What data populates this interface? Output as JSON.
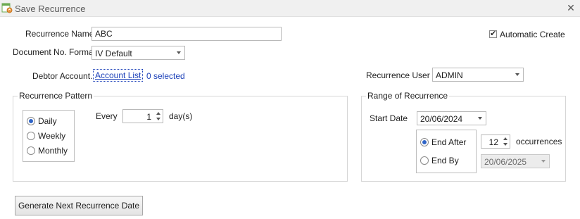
{
  "window": {
    "title": "Save Recurrence",
    "close_symbol": "✕"
  },
  "form": {
    "recurrence_name_label": "Recurrence Name",
    "recurrence_name_value": "ABC",
    "doc_format_label": "Document No. Format",
    "doc_format_value": "IV Default",
    "debtor_account_label": "Debtor Account.",
    "account_list_link": "Account List",
    "selected_text": "0 selected",
    "automatic_create_label": "Automatic Create",
    "automatic_create_checked": true,
    "recurrence_user_label": "Recurrence User",
    "recurrence_user_value": "ADMIN"
  },
  "pattern": {
    "title": "Recurrence Pattern",
    "options": [
      {
        "label": "Daily",
        "checked": true
      },
      {
        "label": "Weekly",
        "checked": false
      },
      {
        "label": "Monthly",
        "checked": false
      }
    ],
    "every_label": "Every",
    "every_value": "1",
    "unit_label": "day(s)"
  },
  "range": {
    "title": "Range of Recurrence",
    "start_date_label": "Start Date",
    "start_date_value": "20/06/2024",
    "end_after_label": "End After",
    "end_after_checked": true,
    "occurrences_value": "12",
    "occurrences_label": "occurrences",
    "end_by_label": "End By",
    "end_by_checked": false,
    "end_by_value": "20/06/2025"
  },
  "buttons": {
    "generate_label": "Generate Next Recurrence Date"
  }
}
